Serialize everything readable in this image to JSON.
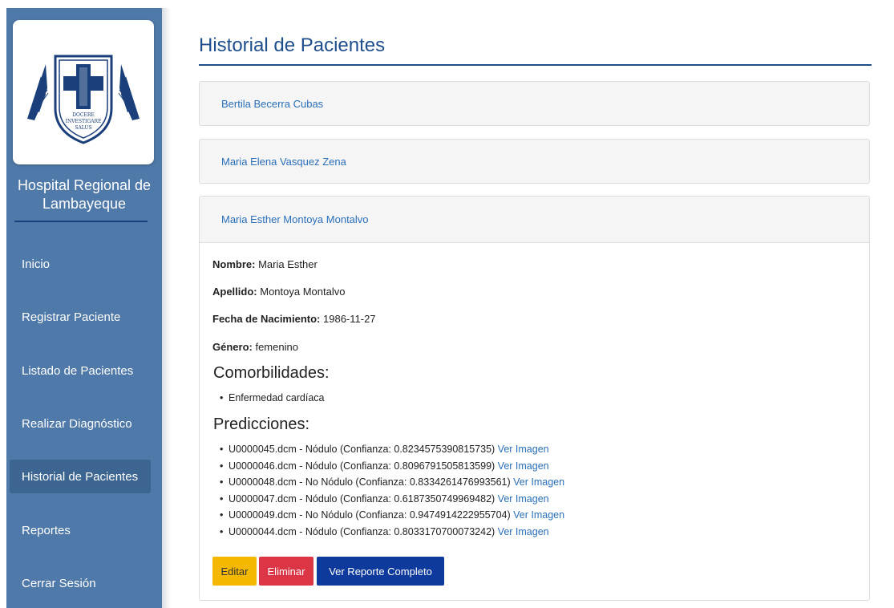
{
  "sidebar": {
    "logo": {
      "motto": [
        "DOCERE",
        "INVESTIGARE",
        "SALUS"
      ]
    },
    "hospital_name": "Hospital Regional de Lambayeque",
    "items": [
      {
        "label": "Inicio",
        "active": false
      },
      {
        "label": "Registrar Paciente",
        "active": false
      },
      {
        "label": "Listado de Pacientes",
        "active": false
      },
      {
        "label": "Realizar Diagnóstico",
        "active": false
      },
      {
        "label": "Historial de Pacientes",
        "active": true
      },
      {
        "label": "Reportes",
        "active": false
      },
      {
        "label": "Cerrar Sesión",
        "active": false
      }
    ]
  },
  "main": {
    "title": "Historial de Pacientes",
    "patients": [
      {
        "name": "Bertila Becerra Cubas"
      },
      {
        "name": "Maria Elena Vasquez Zena"
      },
      {
        "name": "Maria Esther Montoya Montalvo"
      }
    ],
    "detail": {
      "nombre_label": "Nombre:",
      "nombre": "Maria Esther",
      "apellido_label": "Apellido:",
      "apellido": "Montoya Montalvo",
      "fecha_label": "Fecha de Nacimiento:",
      "fecha": "1986-11-27",
      "genero_label": "Género:",
      "genero": "femenino",
      "comorbilidades_title": "Comorbilidades:",
      "comorbilidades": [
        "Enfermedad cardíaca"
      ],
      "predicciones_title": "Predicciones:",
      "predicciones": [
        {
          "text": "U0000045.dcm - Nódulo (Confianza: 0.8234575390815735)",
          "link": "Ver Imagen"
        },
        {
          "text": "U0000046.dcm - Nódulo (Confianza: 0.8096791505813599)",
          "link": "Ver Imagen"
        },
        {
          "text": "U0000048.dcm - No Nódulo (Confianza: 0.8334261476993561)",
          "link": "Ver Imagen"
        },
        {
          "text": "U0000047.dcm - Nódulo (Confianza: 0.6187350749969482)",
          "link": "Ver Imagen"
        },
        {
          "text": "U0000049.dcm - No Nódulo (Confianza: 0.9474914222955704)",
          "link": "Ver Imagen"
        },
        {
          "text": "U0000044.dcm - Nódulo (Confianza: 0.8033170700073242)",
          "link": "Ver Imagen"
        }
      ]
    },
    "buttons": {
      "edit": "Editar",
      "delete": "Eliminar",
      "report": "Ver Reporte Completo"
    }
  },
  "colors": {
    "sidebar_bg": "#4f79a8",
    "sidebar_active": "#3c6591",
    "title": "#1f4e8c",
    "link": "#2a6fba",
    "edit_button": "#f5b800",
    "delete_button": "#dc3545",
    "report_button": "#0d3a9c"
  }
}
